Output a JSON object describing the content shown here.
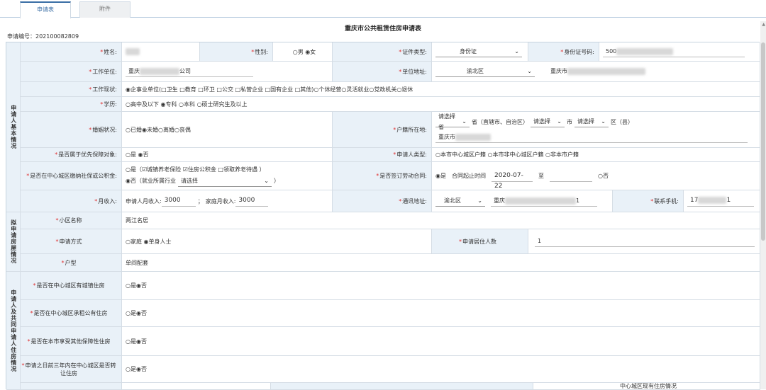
{
  "tabs": [
    "申请表",
    "附件"
  ],
  "title": "重庆市公共租赁住房申请表",
  "app_no": "申请编号：202100082809",
  "sections": {
    "basic": "申请人基本情况",
    "house": "拟申请房屋情况",
    "housing": "申请人及共同申请人住房情况"
  },
  "r1": {
    "name_l": "姓名:",
    "gender_l": "性别:",
    "gender_v": "○男 ◉女",
    "idtype_l": "证件类型:",
    "idtype_v": "身份证",
    "idno_l": "身份证号码:",
    "idno_v": "500"
  },
  "r2": {
    "work_l": "工作单位:",
    "work_v1": "重庆",
    "work_v2": "公司",
    "addr_l": "单位地址:",
    "addr_sel": "渝北区",
    "addr_v": "重庆市"
  },
  "r3": {
    "l": "工作现状:",
    "v": "◉企事业单位(□卫生 □教育 □环卫 □公交 □私营企业 □国有企业 □其他)○个体经营○灵活就业○党政机关○退休"
  },
  "r4": {
    "l": "学历:",
    "v": "○高中及以下 ◉专科 ○本科 ○硕士研究生及以上"
  },
  "r5": {
    "l": "婚姻状况:",
    "v": "○已婚◉未婚○离婚○丧偶",
    "hk_l": "户籍所在地:",
    "hk_s1": "请选择省",
    "hk_t1": "省（直辖市、自治区）",
    "hk_s2": "请选择",
    "hk_t2": "市",
    "hk_s3": "请选择",
    "hk_t3": "区（县）",
    "hk_addr": "重庆市"
  },
  "r6": {
    "l": "是否属于优先保障对象:",
    "v": "○是 ◉否",
    "type_l": "申请人类型:",
    "type_v": "○本市中心城区户籍 ○本市非中心城区户籍 ○非本市户籍"
  },
  "r7": {
    "l": "是否在中心城区缴纳社保或公积金:",
    "v1": "○是（☑城镇养老保险 ☑住房公积金 □领取养老待遇 ）",
    "v2": "◉否（就业所属行业",
    "v2sel": "请选择",
    "v2end": "）",
    "ct_l": "是否签订劳动合同:",
    "ct_yes": "◉是",
    "ct_t": "合同起止时间",
    "ct_d": "2020-07-22",
    "ct_to": "至",
    "ct_no": "○否"
  },
  "r8": {
    "l": "月收入:",
    "p": "申请人月收入:",
    "pv": "3000",
    "sep": "；",
    "f": "家庭月收入:",
    "fv": "3000",
    "mail_l": "通讯地址:",
    "mail_sel": "渝北区",
    "mail_v": "重庆",
    "mail_end": "1",
    "tel_l": "联系手机:",
    "tel_v": "17",
    "tel_end": "1"
  },
  "r9": {
    "l": "小区名称",
    "v": "两江名居"
  },
  "r10": {
    "l": "申请方式",
    "v": "○家庭 ◉单身人士",
    "n_l": "申请居住人数",
    "n_v": "1"
  },
  "r11": {
    "l": "户型",
    "v": "单间配套"
  },
  "r12": {
    "l": "是否在中心城区有城镇住房",
    "v": "○是◉否"
  },
  "r13": {
    "l": "是否在中心城区承租公有住房",
    "v": "○是◉否"
  },
  "r14": {
    "l": "是否在本市享受其他保障性住房",
    "v": "○是◉否"
  },
  "r15": {
    "l": "申请之日前三年内在中心城区是否转让住房",
    "v": "○是◉否"
  },
  "r16": {
    "t": "中心城区现有住房情况"
  },
  "colors": {
    "label_bg": "#e9f1f8",
    "required": "#e03030",
    "border": "#d5dde5"
  }
}
